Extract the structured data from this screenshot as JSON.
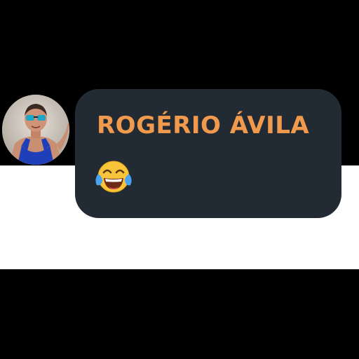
{
  "message": {
    "sender_name": "ROGÉRIO ÁVILA",
    "emoji_icon": "face-with-tears-of-joy-icon"
  },
  "colors": {
    "bubble_background": "#222b33",
    "sender_name": "#f19a4d",
    "emoji_face": "#f8c43a"
  }
}
